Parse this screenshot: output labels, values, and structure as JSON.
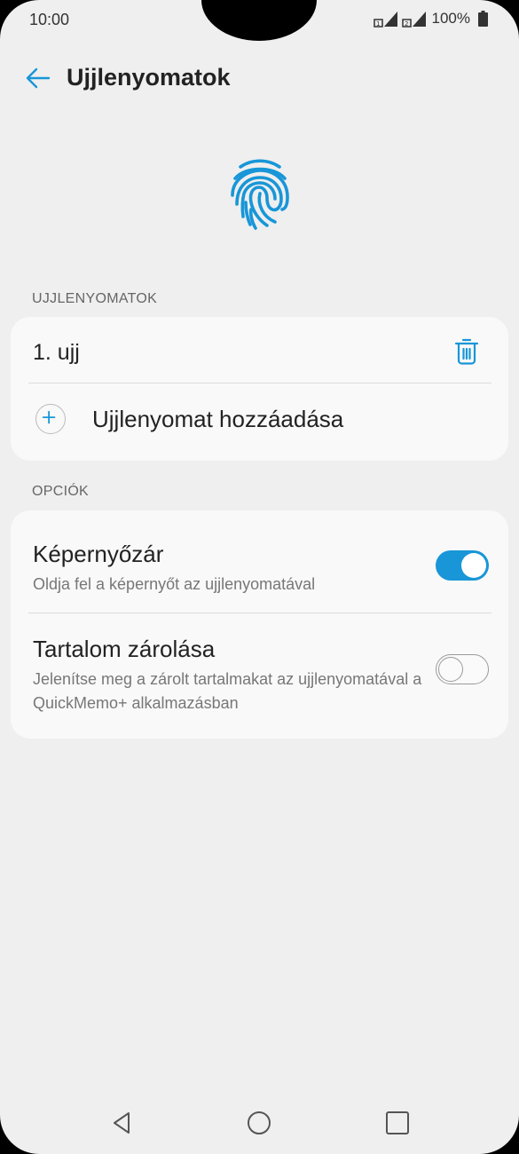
{
  "status": {
    "time": "10:00",
    "battery": "100%"
  },
  "appbar": {
    "title": "Ujjlenyomatok"
  },
  "fingerprints": {
    "section_label": "UJJLENYOMATOK",
    "items": [
      {
        "label": "1. ujj"
      }
    ],
    "add_label": "Ujjlenyomat hozzáadása"
  },
  "options": {
    "section_label": "OPCIÓK",
    "items": [
      {
        "title": "Képernyőzár",
        "subtitle": "Oldja fel a képernyőt az ujjlenyomatával",
        "enabled": true
      },
      {
        "title": "Tartalom zárolása",
        "subtitle": "Jelenítse meg a zárolt tartalmakat az ujjlenyomatával a QuickMemo+ alkalmazásban",
        "enabled": false
      }
    ]
  },
  "colors": {
    "accent": "#1896d8",
    "background": "#efefef",
    "card": "#f9f9f9"
  },
  "icons": [
    "back-arrow-icon",
    "fingerprint-icon",
    "trash-icon",
    "plus-icon",
    "nav-back-icon",
    "nav-home-icon",
    "nav-recents-icon"
  ]
}
